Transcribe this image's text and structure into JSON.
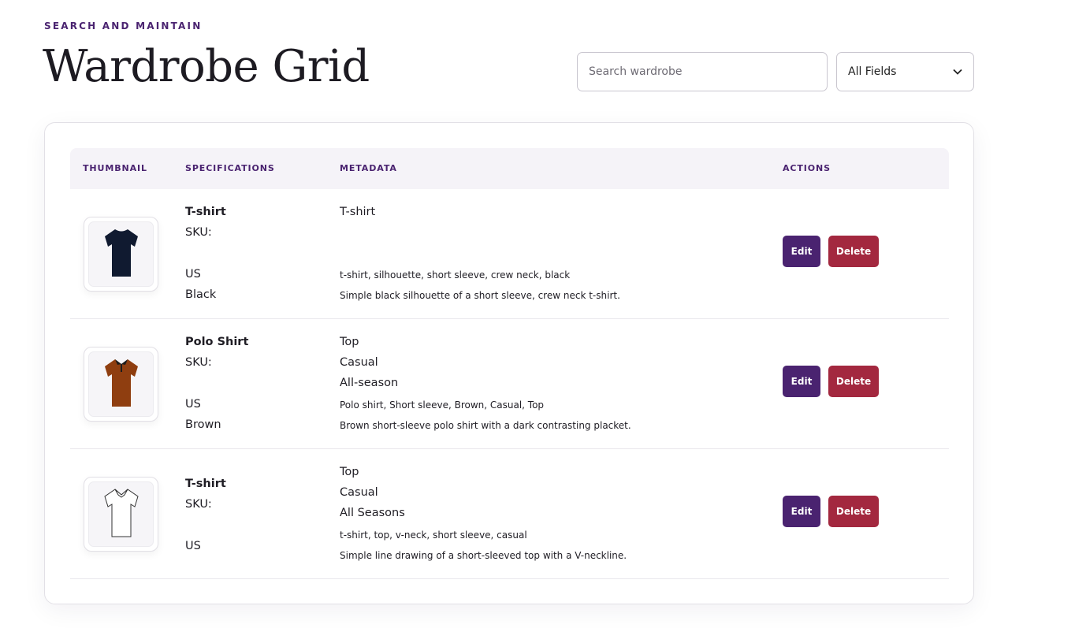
{
  "header": {
    "eyebrow": "SEARCH AND MAINTAIN",
    "title": "Wardrobe Grid"
  },
  "search": {
    "placeholder": "Search wardrobe",
    "value": ""
  },
  "filter": {
    "selected": "All Fields"
  },
  "table": {
    "columns": [
      "THUMBNAIL",
      "SPECIFICATIONS",
      "METADATA",
      "ACTIONS"
    ],
    "edit_label": "Edit",
    "delete_label": "Delete",
    "rows": [
      {
        "name": "T-shirt",
        "sku_label": "SKU:",
        "region": "US",
        "color": "Black",
        "meta_lines": [
          "T-shirt"
        ],
        "tags": "t-shirt, silhouette, short sleeve, crew neck, black",
        "description": "Simple black silhouette of a short sleeve, crew neck t-shirt.",
        "thumb_icon": "black-tshirt-icon"
      },
      {
        "name": "Polo Shirt",
        "sku_label": "SKU:",
        "region": "US",
        "color": "Brown",
        "meta_lines": [
          "Top",
          "Casual",
          "All-season"
        ],
        "tags": "Polo shirt, Short sleeve, Brown, Casual, Top",
        "description": "Brown short-sleeve polo shirt with a dark contrasting placket.",
        "thumb_icon": "brown-polo-shirt-icon"
      },
      {
        "name": "T-shirt",
        "sku_label": "SKU:",
        "region": "US",
        "color": "",
        "meta_lines": [
          "Top",
          "Casual",
          "All Seasons"
        ],
        "tags": "t-shirt, top, v-neck, short sleeve, casual",
        "description": "Simple line drawing of a short-sleeved top with a V-neckline.",
        "thumb_icon": "white-vneck-top-icon"
      }
    ]
  },
  "colors": {
    "accent": "#4a2370",
    "danger": "#a3283f",
    "header_bg": "#f5f3f8"
  }
}
